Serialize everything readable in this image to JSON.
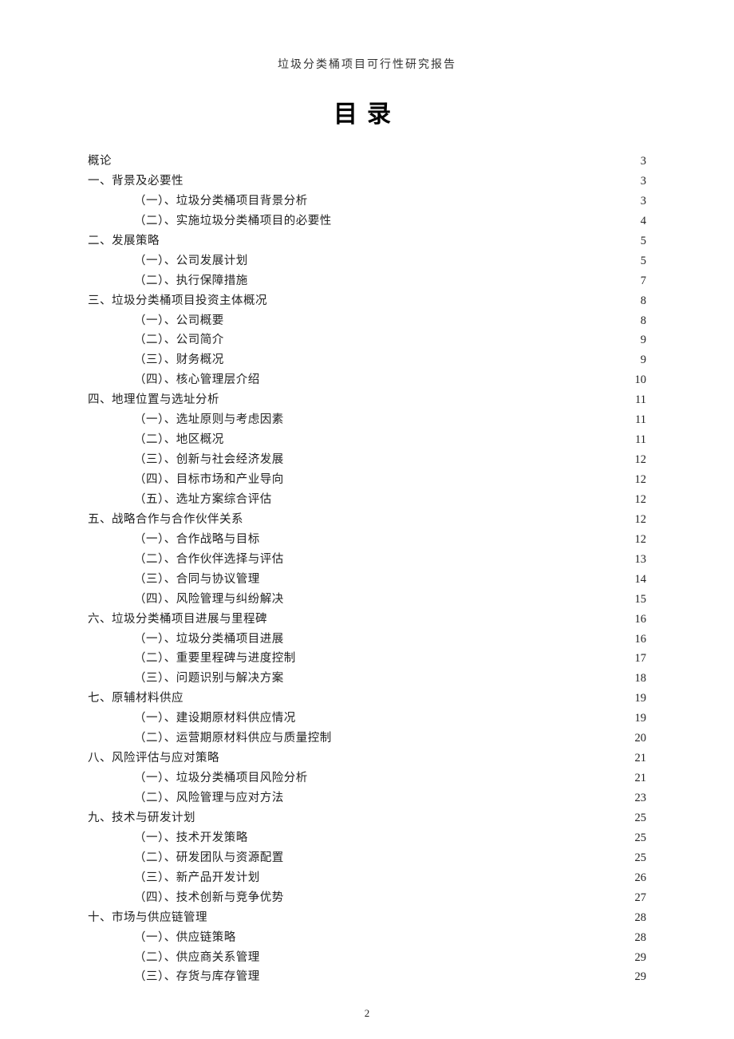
{
  "header": "垃圾分类桶项目可行性研究报告",
  "title": "目录",
  "page_number": "2",
  "toc": [
    {
      "level": 0,
      "label": "概论",
      "page": "3"
    },
    {
      "level": 0,
      "label": "一、背景及必要性",
      "page": "3"
    },
    {
      "level": 1,
      "label": "（一）、垃圾分类桶项目背景分析",
      "page": "3"
    },
    {
      "level": 1,
      "label": "（二）、实施垃圾分类桶项目的必要性",
      "page": "4"
    },
    {
      "level": 0,
      "label": "二、发展策略",
      "page": "5"
    },
    {
      "level": 1,
      "label": "（一）、公司发展计划",
      "page": "5"
    },
    {
      "level": 1,
      "label": "（二）、执行保障措施",
      "page": "7"
    },
    {
      "level": 0,
      "label": "三、垃圾分类桶项目投资主体概况",
      "page": "8"
    },
    {
      "level": 1,
      "label": "（一）、公司概要",
      "page": "8"
    },
    {
      "level": 1,
      "label": "（二）、公司简介",
      "page": "9"
    },
    {
      "level": 1,
      "label": "（三）、财务概况",
      "page": "9"
    },
    {
      "level": 1,
      "label": "（四）、核心管理层介绍",
      "page": "10"
    },
    {
      "level": 0,
      "label": "四、地理位置与选址分析",
      "page": "11"
    },
    {
      "level": 1,
      "label": "（一）、选址原则与考虑因素",
      "page": "11"
    },
    {
      "level": 1,
      "label": "（二）、地区概况",
      "page": "11"
    },
    {
      "level": 1,
      "label": "（三）、创新与社会经济发展",
      "page": "12"
    },
    {
      "level": 1,
      "label": "（四）、目标市场和产业导向",
      "page": "12"
    },
    {
      "level": 1,
      "label": "（五）、选址方案综合评估",
      "page": "12"
    },
    {
      "level": 0,
      "label": "五、战略合作与合作伙伴关系",
      "page": "12"
    },
    {
      "level": 1,
      "label": "（一）、合作战略与目标",
      "page": "12"
    },
    {
      "level": 1,
      "label": "（二）、合作伙伴选择与评估",
      "page": "13"
    },
    {
      "level": 1,
      "label": "（三）、合同与协议管理",
      "page": "14"
    },
    {
      "level": 1,
      "label": "（四）、风险管理与纠纷解决",
      "page": "15"
    },
    {
      "level": 0,
      "label": "六、垃圾分类桶项目进展与里程碑",
      "page": "16"
    },
    {
      "level": 1,
      "label": "（一）、垃圾分类桶项目进展",
      "page": "16"
    },
    {
      "level": 1,
      "label": "（二）、重要里程碑与进度控制",
      "page": "17"
    },
    {
      "level": 1,
      "label": "（三）、问题识别与解决方案",
      "page": "18"
    },
    {
      "level": 0,
      "label": "七、原辅材料供应",
      "page": "19"
    },
    {
      "level": 1,
      "label": "（一）、建设期原材料供应情况",
      "page": "19"
    },
    {
      "level": 1,
      "label": "（二）、运营期原材料供应与质量控制",
      "page": "20"
    },
    {
      "level": 0,
      "label": "八、风险评估与应对策略",
      "page": "21"
    },
    {
      "level": 1,
      "label": "（一）、垃圾分类桶项目风险分析",
      "page": "21"
    },
    {
      "level": 1,
      "label": "（二）、风险管理与应对方法",
      "page": "23"
    },
    {
      "level": 0,
      "label": "九、技术与研发计划",
      "page": "25"
    },
    {
      "level": 1,
      "label": "（一）、技术开发策略",
      "page": "25"
    },
    {
      "level": 1,
      "label": "（二）、研发团队与资源配置",
      "page": "25"
    },
    {
      "level": 1,
      "label": "（三）、新产品开发计划",
      "page": "26"
    },
    {
      "level": 1,
      "label": "（四）、技术创新与竞争优势",
      "page": "27"
    },
    {
      "level": 0,
      "label": "十、市场与供应链管理",
      "page": "28"
    },
    {
      "level": 1,
      "label": "（一）、供应链策略",
      "page": "28"
    },
    {
      "level": 1,
      "label": "（二）、供应商关系管理",
      "page": "29"
    },
    {
      "level": 1,
      "label": "（三）、存货与库存管理",
      "page": "29"
    }
  ]
}
